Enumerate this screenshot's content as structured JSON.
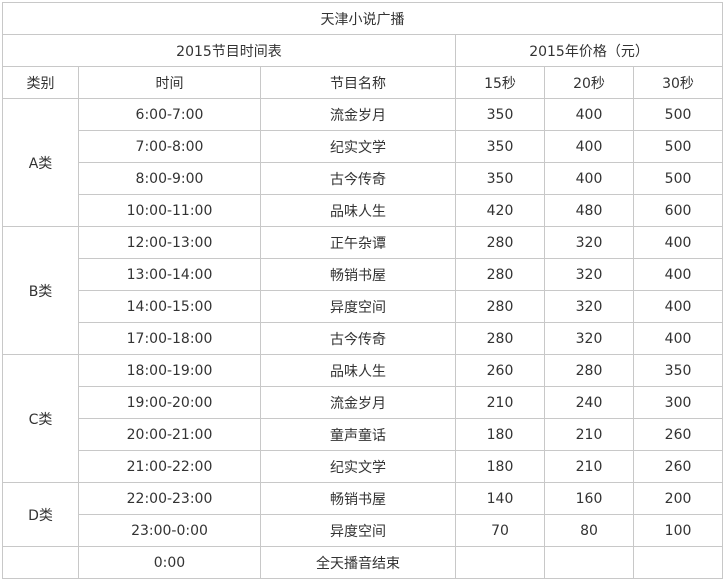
{
  "title": "天津小说广播",
  "schedule_header": "2015节目时间表",
  "price_header": "2015年价格（元）",
  "columns": {
    "category": "类别",
    "time": "时间",
    "program": "节目名称",
    "p15": "15秒",
    "p20": "20秒",
    "p30": "30秒"
  },
  "groups": [
    {
      "category": "A类",
      "rows": [
        {
          "time": "6:00-7:00",
          "program": "流金岁月",
          "p15": "350",
          "p20": "400",
          "p30": "500"
        },
        {
          "time": "7:00-8:00",
          "program": "纪实文学",
          "p15": "350",
          "p20": "400",
          "p30": "500"
        },
        {
          "time": "8:00-9:00",
          "program": "古今传奇",
          "p15": "350",
          "p20": "400",
          "p30": "500"
        },
        {
          "time": "10:00-11:00",
          "program": "品味人生",
          "p15": "420",
          "p20": "480",
          "p30": "600"
        }
      ]
    },
    {
      "category": "B类",
      "rows": [
        {
          "time": "12:00-13:00",
          "program": "正午杂谭",
          "p15": "280",
          "p20": "320",
          "p30": "400"
        },
        {
          "time": "13:00-14:00",
          "program": "畅销书屋",
          "p15": "280",
          "p20": "320",
          "p30": "400"
        },
        {
          "time": "14:00-15:00",
          "program": "异度空间",
          "p15": "280",
          "p20": "320",
          "p30": "400"
        },
        {
          "time": "17:00-18:00",
          "program": "古今传奇",
          "p15": "280",
          "p20": "320",
          "p30": "400"
        }
      ]
    },
    {
      "category": "C类",
      "rows": [
        {
          "time": "18:00-19:00",
          "program": "品味人生",
          "p15": "260",
          "p20": "280",
          "p30": "350"
        },
        {
          "time": "19:00-20:00",
          "program": "流金岁月",
          "p15": "210",
          "p20": "240",
          "p30": "300"
        },
        {
          "time": "20:00-21:00",
          "program": "童声童话",
          "p15": "180",
          "p20": "210",
          "p30": "260"
        },
        {
          "time": "21:00-22:00",
          "program": "纪实文学",
          "p15": "180",
          "p20": "210",
          "p30": "260"
        }
      ]
    },
    {
      "category": "D类",
      "rows": [
        {
          "time": "22:00-23:00",
          "program": "畅销书屋",
          "p15": "140",
          "p20": "160",
          "p30": "200"
        },
        {
          "time": "23:00-0:00",
          "program": "异度空间",
          "p15": "70",
          "p20": "80",
          "p30": "100"
        }
      ]
    }
  ],
  "footer": {
    "time": "0:00",
    "program": "全天播音结束"
  }
}
